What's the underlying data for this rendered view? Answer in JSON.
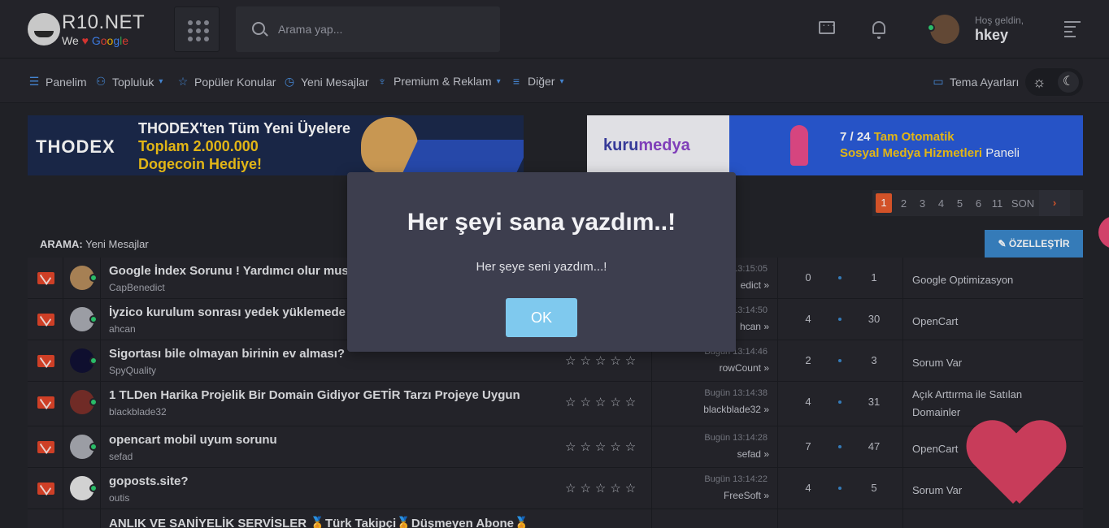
{
  "header": {
    "logo_text": "R10.NET",
    "logo_tag_we": "We",
    "logo_tag_google": [
      "G",
      "o",
      "o",
      "g",
      "l",
      "e"
    ],
    "search_placeholder": "Arama yap...",
    "greeting": "Hoş geldin,",
    "username": "hkey"
  },
  "nav": {
    "items": [
      {
        "label": "Panelim",
        "icon": "sliders-icon"
      },
      {
        "label": "Topluluk",
        "icon": "community-icon",
        "dropdown": true
      },
      {
        "label": "Popüler Konular",
        "icon": "star-icon"
      },
      {
        "label": "Yeni Mesajlar",
        "icon": "clock-icon"
      },
      {
        "label": "Premium & Reklam",
        "icon": "premium-icon",
        "dropdown": true
      },
      {
        "label": "Diğer",
        "icon": "list-icon",
        "dropdown": true
      }
    ],
    "theme_label": "Tema Ayarları"
  },
  "banners": {
    "thodex": {
      "brand": "THODEX",
      "line1": "THODEX'ten Tüm Yeni Üyelere",
      "line2": "Toplam 2.000.000",
      "line3": "Dogecoin Hediye!"
    },
    "kurumedya": {
      "brand_a": "kuru",
      "brand_b": "medya",
      "line1_prefix": "7 / 24",
      "line1_rest": "Tam Otomatik",
      "line2_bold": "Sosyal Medya Hizmetleri",
      "line2_rest": "Paneli"
    }
  },
  "pagination": {
    "pages": [
      "1",
      "2",
      "3",
      "4",
      "5",
      "6",
      "11"
    ],
    "active": "1",
    "last_label": "SON",
    "next_label": "›"
  },
  "section": {
    "prefix": "ARAMA:",
    "title": "Yeni Mesajlar",
    "customize_label": "ÖZELLEŞTİR"
  },
  "threads": [
    {
      "title": "Google İndex Sorunu ! Yardımcı olur musu",
      "author": "CapBenedict",
      "last_time": "13:15:05",
      "last_user": "edict",
      "replies": "0",
      "views": "1",
      "forum": "Google Optimizasyon",
      "stars": "☆ ☆ ☆ ☆ ☆",
      "show_stars": false
    },
    {
      "title": "İyzico kurulum sonrası yedek yüklemede h",
      "author": "ahcan",
      "last_time": "13:14:50",
      "last_user": "hcan",
      "replies": "4",
      "views": "30",
      "forum": "OpenCart",
      "stars": "☆ ☆ ☆ ☆ ☆",
      "show_stars": false
    },
    {
      "title": "Sigortası bile olmayan birinin ev alması?",
      "author": "SpyQuality",
      "last_time": "Bugün 13:14:46",
      "last_user": "rowCount",
      "replies": "2",
      "views": "3",
      "forum": "Sorum Var",
      "stars": "☆☆☆☆☆",
      "show_stars": true
    },
    {
      "title": "1 TLDen Harika Projelik Bir Domain Gidiyor GETİR Tarzı Projeye Uygun",
      "author": "blackblade32",
      "last_time": "Bugün 13:14:38",
      "last_user": "blackblade32",
      "replies": "4",
      "views": "31",
      "forum": "Açık Arttırma ile Satılan Domainler",
      "stars": "☆☆☆☆☆",
      "show_stars": true
    },
    {
      "title": "opencart mobil uyum sorunu",
      "author": "sefad",
      "last_time": "Bugün 13:14:28",
      "last_user": "sefad",
      "replies": "7",
      "views": "47",
      "forum": "OpenCart",
      "stars": "☆☆☆☆☆",
      "show_stars": true
    },
    {
      "title": "goposts.site?",
      "author": "outis",
      "last_time": "Bugün 13:14:22",
      "last_user": "FreeSoft",
      "replies": "4",
      "views": "5",
      "forum": "Sorum Var",
      "stars": "☆☆☆☆☆",
      "show_stars": true
    },
    {
      "title": "ANLIK VE SANİYELİK SERVİSLER 🏅Türk Takipçi🏅Düşmeyen Abone🏅",
      "author": "",
      "last_time": "",
      "last_user": "",
      "replies": "",
      "views": "",
      "forum": "",
      "stars": "",
      "show_stars": false
    }
  ],
  "modal": {
    "title": "Her şeyi sana yazdım..!",
    "text": "Her şeye seni yazdım...!",
    "ok_label": "OK"
  },
  "colors": {
    "accent": "#3a86c8",
    "envelope": "#e0452a",
    "active_page": "#e45a2c",
    "online": "#2ecc71",
    "ok_button": "#7fc9ee",
    "heart": "#c83c5a"
  }
}
